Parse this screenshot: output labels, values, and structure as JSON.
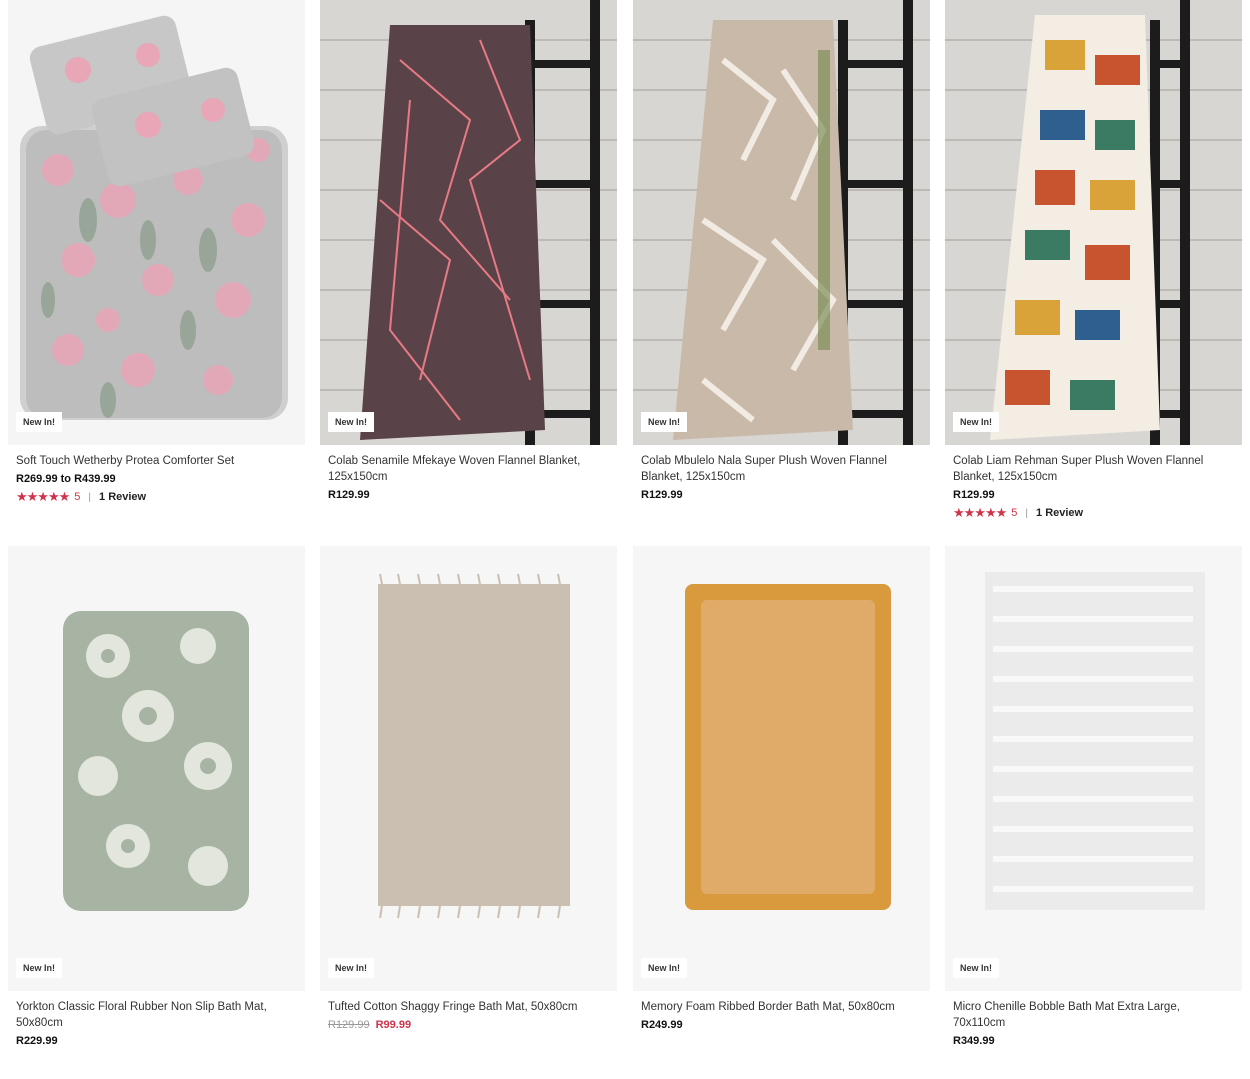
{
  "products": [
    {
      "badge": "New In!",
      "name": "Soft Touch Wetherby Protea Comforter Set",
      "price": "R269.99 to R439.99",
      "rating": {
        "stars": 5,
        "score": "5",
        "sep": "|",
        "reviews": "1 Review"
      },
      "image": "comforter-protea"
    },
    {
      "badge": "New In!",
      "name": "Colab Senamile Mfekaye Woven Flannel Blanket, 125x150cm",
      "price": "R129.99",
      "image": "blanket-brown-pink"
    },
    {
      "badge": "New In!",
      "name": "Colab Mbulelo Nala Super Plush Woven Flannel Blanket, 125x150cm",
      "price": "R129.99",
      "image": "blanket-beige-pattern"
    },
    {
      "badge": "New In!",
      "name": "Colab Liam Rehman Super Plush Woven Flannel Blanket, 125x150cm",
      "price": "R129.99",
      "rating": {
        "stars": 5,
        "score": "5",
        "sep": "|",
        "reviews": "1 Review"
      },
      "image": "blanket-multicolor"
    },
    {
      "badge": "New In!",
      "name": "Yorkton Classic Floral Rubber Non Slip Bath Mat, 50x80cm",
      "price": "R229.99",
      "image": "bathmat-green-floral"
    },
    {
      "badge": "New In!",
      "name": "Tufted Cotton Shaggy Fringe Bath Mat, 50x80cm",
      "old_price": "R129.99",
      "price": "R99.99",
      "image": "bathmat-shaggy-beige"
    },
    {
      "badge": "New In!",
      "name": "Memory Foam Ribbed Border Bath Mat, 50x80cm",
      "price": "R249.99",
      "image": "bathmat-mustard"
    },
    {
      "badge": "New In!",
      "name": "Micro Chenille Bobble Bath Mat Extra Large, 70x110cm",
      "price": "R349.99",
      "image": "bathmat-white-chenille"
    }
  ],
  "colors": {
    "sale": "#d0334a",
    "star": "#d0334a"
  }
}
